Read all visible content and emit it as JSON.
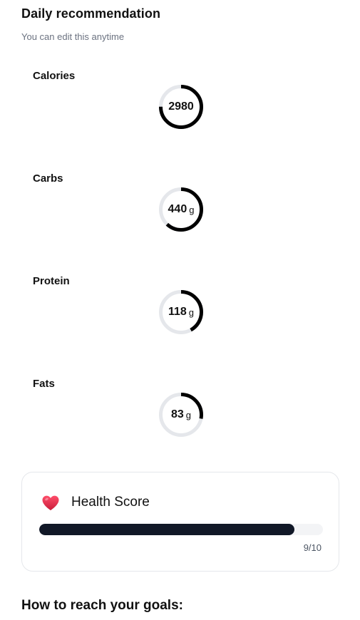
{
  "header": {
    "title": "Daily recommendation",
    "subtitle": "You can edit this anytime"
  },
  "macros": [
    {
      "label": "Calories",
      "value": "2980",
      "unit": "",
      "progress": 0.75
    },
    {
      "label": "Carbs",
      "value": "440",
      "unit": "g",
      "progress": 0.62
    },
    {
      "label": "Protein",
      "value": "118",
      "unit": "g",
      "progress": 0.42
    },
    {
      "label": "Fats",
      "value": "83",
      "unit": "g",
      "progress": 0.28
    }
  ],
  "health_score": {
    "title": "Health Score",
    "score_text": "9/10",
    "progress": 0.9,
    "icon": "heart-icon"
  },
  "goals": {
    "title": "How to reach your goals:"
  },
  "colors": {
    "ring": "#000000",
    "ring_track": "#e5e7eb",
    "bar": "#111827",
    "bar_track": "#f3f4f6",
    "heart": "#e11d48"
  }
}
